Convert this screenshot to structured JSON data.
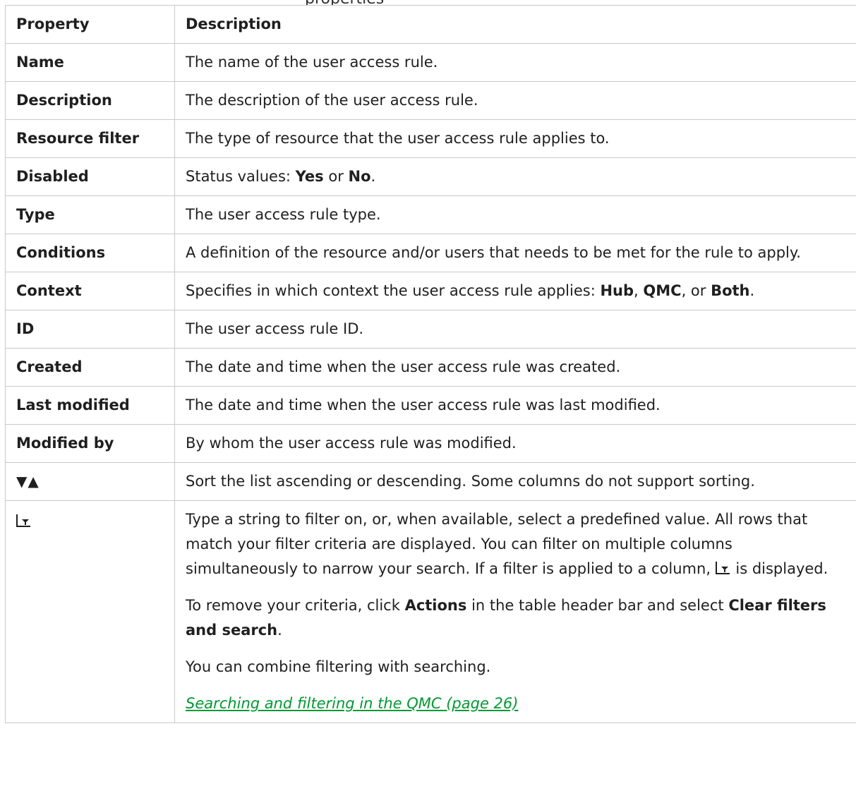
{
  "page_header_text": "properties",
  "table": {
    "headers": {
      "property": "Property",
      "description": "Description"
    },
    "rows": [
      {
        "name": "Name",
        "desc": "The name of the user access rule."
      },
      {
        "name": "Description",
        "desc": "The description of the user access rule."
      },
      {
        "name": "Resource filter",
        "desc": "The type of resource that the user access rule applies to."
      },
      {
        "name": "Disabled",
        "desc_pre": "Status values: ",
        "bold1": "Yes",
        "mid": " or ",
        "bold2": "No",
        "end": "."
      },
      {
        "name": "Type",
        "desc": "The user access rule type."
      },
      {
        "name": "Conditions",
        "desc": "A definition of the resource and/or users that needs to be met for the rule to apply."
      },
      {
        "name": "Context",
        "desc_pre": "Specifies in which context the user access rule applies: ",
        "bold1": "Hub",
        "sep1": ", ",
        "bold2": "QMC",
        "sep2": ", or ",
        "bold3": "Both",
        "end": "."
      },
      {
        "name": "ID",
        "desc": "The user access rule ID."
      },
      {
        "name": "Created",
        "desc": "The date and time when the user access rule was created."
      },
      {
        "name": "Last modified",
        "desc": "The date and time when the user access rule was last modified."
      },
      {
        "name": "Modified by",
        "desc": "By whom the user access rule was modified."
      }
    ],
    "sort_row": {
      "icon": "sort-arrows-icon",
      "glyph": "▼▲",
      "desc": "Sort the list ascending or descending. Some columns do not support sorting."
    },
    "filter_row": {
      "icon": "filter-icon",
      "p1_pre": "Type a string to filter on, or, when available, select a predefined value. All rows that match your filter criteria are displayed. You can filter on multiple columns simultaneously to narrow your search. If a filter is applied to a column, ",
      "p1_post": " is displayed.",
      "p2_pre": "To remove your criteria, click ",
      "p2_bold1": "Actions",
      "p2_mid": " in the table header bar and select ",
      "p2_bold2": "Clear filters and search",
      "p2_end": ".",
      "p3": "You can combine filtering with searching.",
      "link": "Searching and filtering in the QMC (page 26)"
    }
  },
  "colors": {
    "border": "#c9c9c9",
    "link": "#009933",
    "text": "#1f1f1f"
  }
}
